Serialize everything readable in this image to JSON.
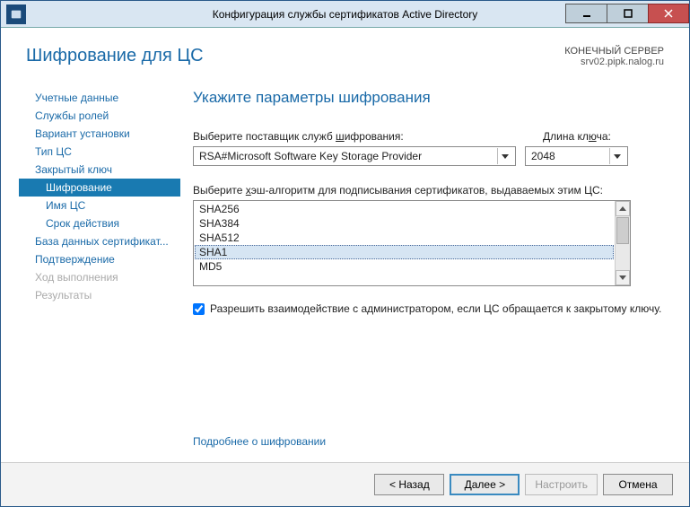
{
  "window": {
    "title": "Конфигурация службы сертификатов Active Directory"
  },
  "header": {
    "page_title": "Шифрование для ЦС",
    "target_label": "КОНЕЧНЫЙ СЕРВЕР",
    "target_server": "srv02.pipk.nalog.ru"
  },
  "sidebar": {
    "items": [
      {
        "label": "Учетные данные"
      },
      {
        "label": "Службы ролей"
      },
      {
        "label": "Вариант установки"
      },
      {
        "label": "Тип ЦС"
      },
      {
        "label": "Закрытый ключ"
      },
      {
        "label": "Шифрование",
        "active": true,
        "sub": true
      },
      {
        "label": "Имя ЦС",
        "sub": true
      },
      {
        "label": "Срок действия",
        "sub": true
      },
      {
        "label": "База данных сертификат..."
      },
      {
        "label": "Подтверждение"
      },
      {
        "label": "Ход выполнения",
        "disabled": true
      },
      {
        "label": "Результаты",
        "disabled": true
      }
    ]
  },
  "main": {
    "section_title": "Укажите параметры шифрования",
    "provider_label_pre": "Выберите поставщик служб ",
    "provider_label_u": "ш",
    "provider_label_post": "ифрования:",
    "provider_value": "RSA#Microsoft Software Key Storage Provider",
    "keylen_label_pre": "Длина кл",
    "keylen_label_u": "ю",
    "keylen_label_post": "ча:",
    "keylen_value": "2048",
    "hash_label_pre": "Выберите ",
    "hash_label_u": "х",
    "hash_label_post": "эш-алгоритм для подписывания сертификатов, выдаваемых этим ЦС:",
    "hash_items": [
      "SHA256",
      "SHA384",
      "SHA512",
      "SHA1",
      "MD5"
    ],
    "hash_selected_index": 3,
    "allow_admin_label": "Разрешить взаимодействие с администратором, если ЦС обращается к закрытому ключу.",
    "allow_admin_checked": true,
    "more_link": "Подробнее о шифровании"
  },
  "footer": {
    "back": "< Назад",
    "next": "Далее >",
    "configure": "Настроить",
    "cancel": "Отмена"
  }
}
